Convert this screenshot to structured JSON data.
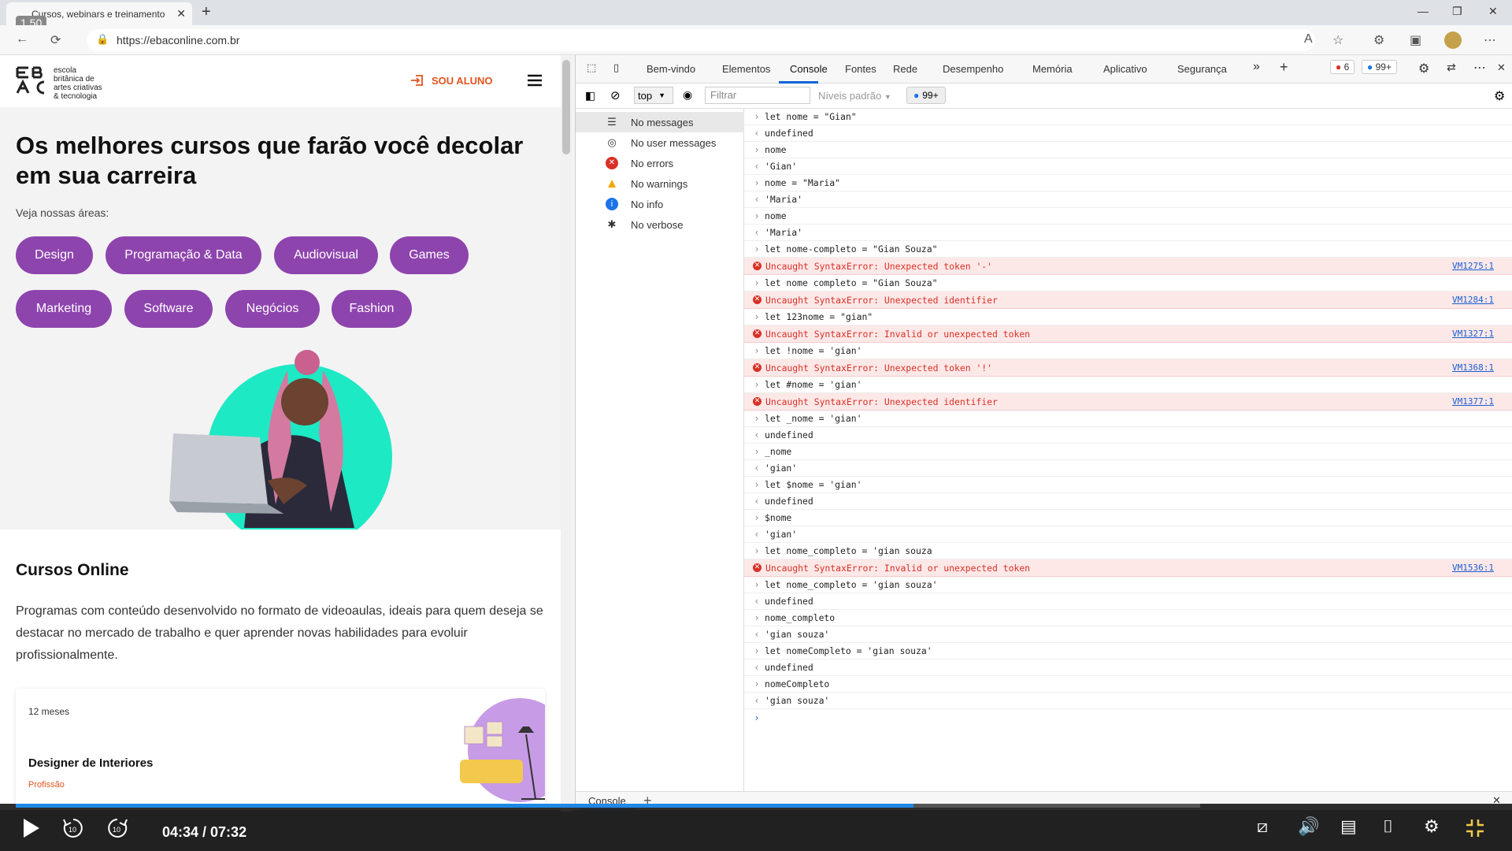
{
  "browser": {
    "tab_title": "Cursos, webinars e treinamento",
    "url": "https://ebaconline.com.br",
    "speed_badge": "1.50"
  },
  "site": {
    "logo_text": "escola\nbritânica de\nartes criativas\n& tecnologia",
    "sou_aluno": "SOU ALUNO",
    "hero_title": "Os melhores cursos que farão você decolar em sua carreira",
    "areas_label": "Veja nossas áreas:",
    "areas": [
      "Design",
      "Programação & Data",
      "Audiovisual",
      "Games",
      "Marketing",
      "Software",
      "Negócios",
      "Fashion"
    ],
    "cursos_title": "Cursos Online",
    "cursos_desc": "Programas com conteúdo desenvolvido no formato de videoaulas, ideais para quem deseja se destacar no mercado de trabalho e quer aprender novas habilidades para evoluir profissionalmente.",
    "card": {
      "duration": "12 meses",
      "name": "Designer de Interiores",
      "type": "Profissão"
    },
    "accent": "#8e44ad",
    "orange": "#e2541e"
  },
  "devtools": {
    "tabs": [
      "Bem-vindo",
      "Elementos",
      "Console",
      "Fontes",
      "Rede",
      "Desempenho",
      "Memória",
      "Aplicativo",
      "Segurança"
    ],
    "active_tab": "Console",
    "errors_count": "6",
    "issues_count": "99+",
    "context": "top",
    "filter_placeholder": "Filtrar",
    "levels": "Níveis padrão",
    "toolbar_issues": "99+",
    "sidebar": [
      {
        "label": "No messages",
        "icon": "list-icon"
      },
      {
        "label": "No user messages",
        "icon": "user-icon"
      },
      {
        "label": "No errors",
        "icon": "error-icon"
      },
      {
        "label": "No warnings",
        "icon": "warning-icon"
      },
      {
        "label": "No info",
        "icon": "info-icon"
      },
      {
        "label": "No verbose",
        "icon": "bug-icon"
      }
    ],
    "console": [
      {
        "kind": "in",
        "text": "let nome = \"Gian\""
      },
      {
        "kind": "out",
        "text": "undefined"
      },
      {
        "kind": "in",
        "text": "nome"
      },
      {
        "kind": "out",
        "text": "'Gian'"
      },
      {
        "kind": "in",
        "text": "nome = \"Maria\""
      },
      {
        "kind": "out",
        "text": "'Maria'"
      },
      {
        "kind": "in",
        "text": "nome"
      },
      {
        "kind": "out",
        "text": "'Maria'"
      },
      {
        "kind": "in",
        "text": "let nome-completo = \"Gian Souza\""
      },
      {
        "kind": "err",
        "text": "Uncaught SyntaxError: Unexpected token '-'",
        "src": "VM1275:1"
      },
      {
        "kind": "in",
        "text": "let nome completo = \"Gian Souza\""
      },
      {
        "kind": "err",
        "text": "Uncaught SyntaxError: Unexpected identifier",
        "src": "VM1284:1"
      },
      {
        "kind": "in",
        "text": "let 123nome = \"gian\""
      },
      {
        "kind": "err",
        "text": "Uncaught SyntaxError: Invalid or unexpected token",
        "src": "VM1327:1"
      },
      {
        "kind": "in",
        "text": "let !nome = 'gian'"
      },
      {
        "kind": "err",
        "text": "Uncaught SyntaxError: Unexpected token '!'",
        "src": "VM1368:1"
      },
      {
        "kind": "in",
        "text": "let #nome = 'gian'"
      },
      {
        "kind": "err",
        "text": "Uncaught SyntaxError: Unexpected identifier",
        "src": "VM1377:1"
      },
      {
        "kind": "in",
        "text": "let _nome = 'gian'"
      },
      {
        "kind": "out",
        "text": "undefined"
      },
      {
        "kind": "in",
        "text": "_nome"
      },
      {
        "kind": "out",
        "text": "'gian'"
      },
      {
        "kind": "in",
        "text": "let $nome = 'gian'"
      },
      {
        "kind": "out",
        "text": "undefined"
      },
      {
        "kind": "in",
        "text": "$nome"
      },
      {
        "kind": "out",
        "text": "'gian'"
      },
      {
        "kind": "in",
        "text": "let nome_completo = 'gian souza"
      },
      {
        "kind": "err",
        "text": "Uncaught SyntaxError: Invalid or unexpected token",
        "src": "VM1536:1"
      },
      {
        "kind": "in",
        "text": "let nome_completo = 'gian souza'"
      },
      {
        "kind": "out",
        "text": "undefined"
      },
      {
        "kind": "in",
        "text": "nome_completo"
      },
      {
        "kind": "out",
        "text": "'gian souza'"
      },
      {
        "kind": "in",
        "text": "let nomeCompleto = 'gian souza'"
      },
      {
        "kind": "out",
        "text": "undefined"
      },
      {
        "kind": "in",
        "text": "nomeCompleto"
      },
      {
        "kind": "out",
        "text": "'gian souza'"
      }
    ],
    "drawer_tab": "Console"
  },
  "player": {
    "time": "04:34 / 07:32",
    "progress": 0.758
  }
}
